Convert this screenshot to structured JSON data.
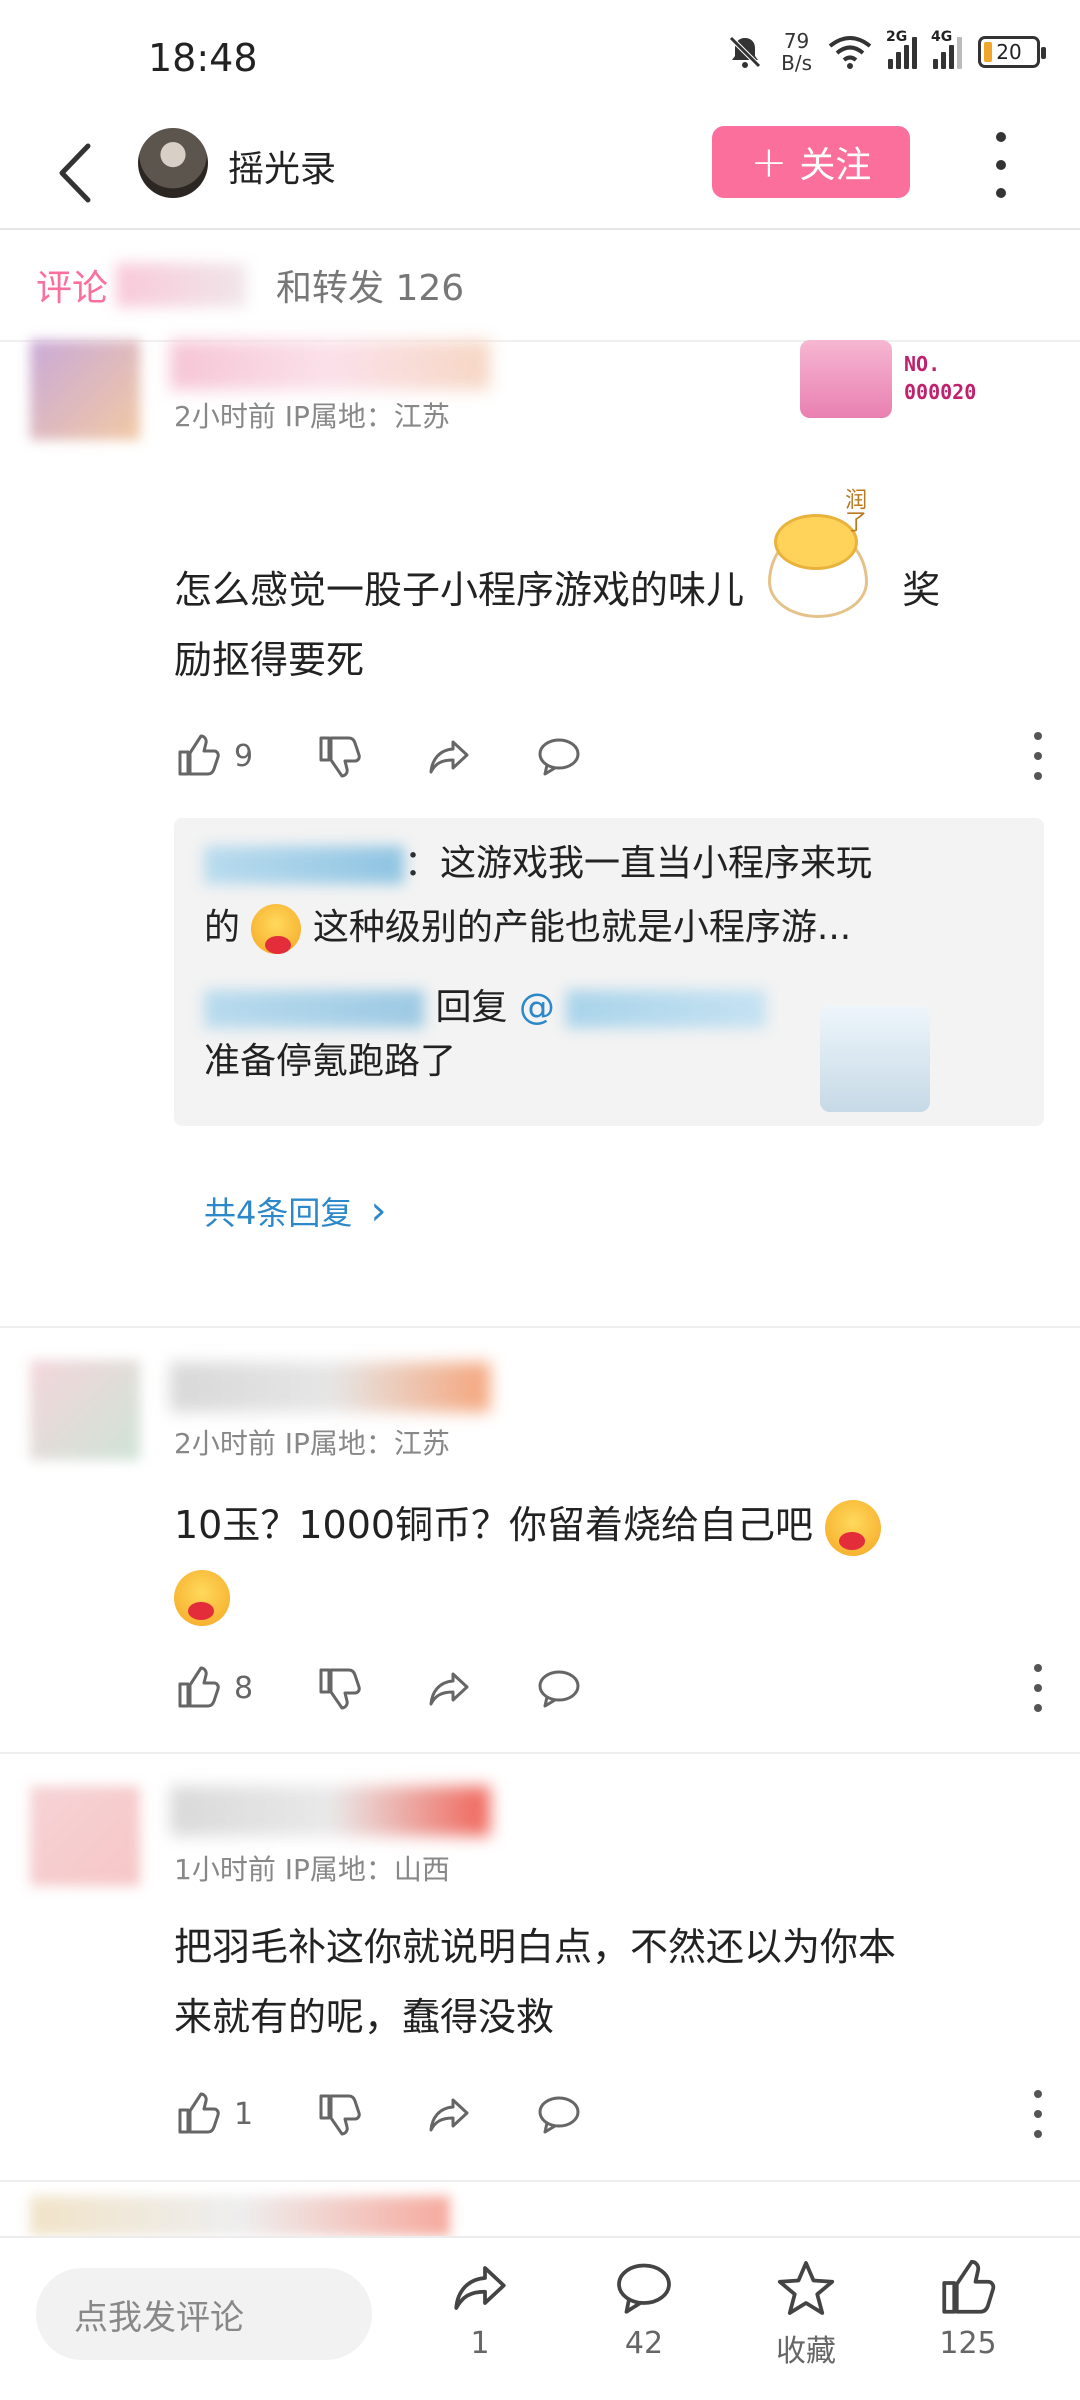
{
  "status_bar": {
    "time": "18:48",
    "net_speed_value": "79",
    "net_speed_unit": "B/s",
    "sim1_tag": "2G",
    "sim2_tag": "4G",
    "battery": "20"
  },
  "header": {
    "author_name": "摇光录",
    "follow_label": "关注",
    "follow_plus": "+"
  },
  "tabs": {
    "comments_label": "评论",
    "reposts_label": "和转发 126"
  },
  "rank_badge": {
    "line1": "NO.",
    "line2": "000020"
  },
  "comments": [
    {
      "meta": "2小时前  IP属地：江苏",
      "text_line1": "怎么感觉一股子小程序游戏的味儿",
      "text_line1_end": "奖",
      "text_line2": "励抠得要死",
      "sticker_tag": "润了",
      "likes": "9",
      "replies": {
        "reply1_suffix": "：这游戏我一直当小程序来玩",
        "reply1_line2_a": "的",
        "reply1_line2_b": "这种级别的产能也就是小程序游...",
        "reply2_mid": "回复",
        "reply2_at": "@",
        "reply2_line2": "准备停氪跑路了",
        "more_label": "共4条回复",
        "more_chevron": "›"
      }
    },
    {
      "meta": "2小时前  IP属地：江苏",
      "text_line1": "10玉？1000铜币？你留着烧给自己吧",
      "likes": "8"
    },
    {
      "meta": "1小时前  IP属地：山西",
      "text_line1": "把羽毛补这你就说明白点，不然还以为你本",
      "text_line2": "来就有的呢，蠢得没救",
      "likes": "1"
    }
  ],
  "bottom_bar": {
    "comment_placeholder": "点我发评论",
    "share_count": "1",
    "comment_count": "42",
    "favorite_label": "收藏",
    "like_count": "125"
  },
  "colors": {
    "accent_pink": "#fb6f9d",
    "link_blue": "#2c88c9"
  }
}
